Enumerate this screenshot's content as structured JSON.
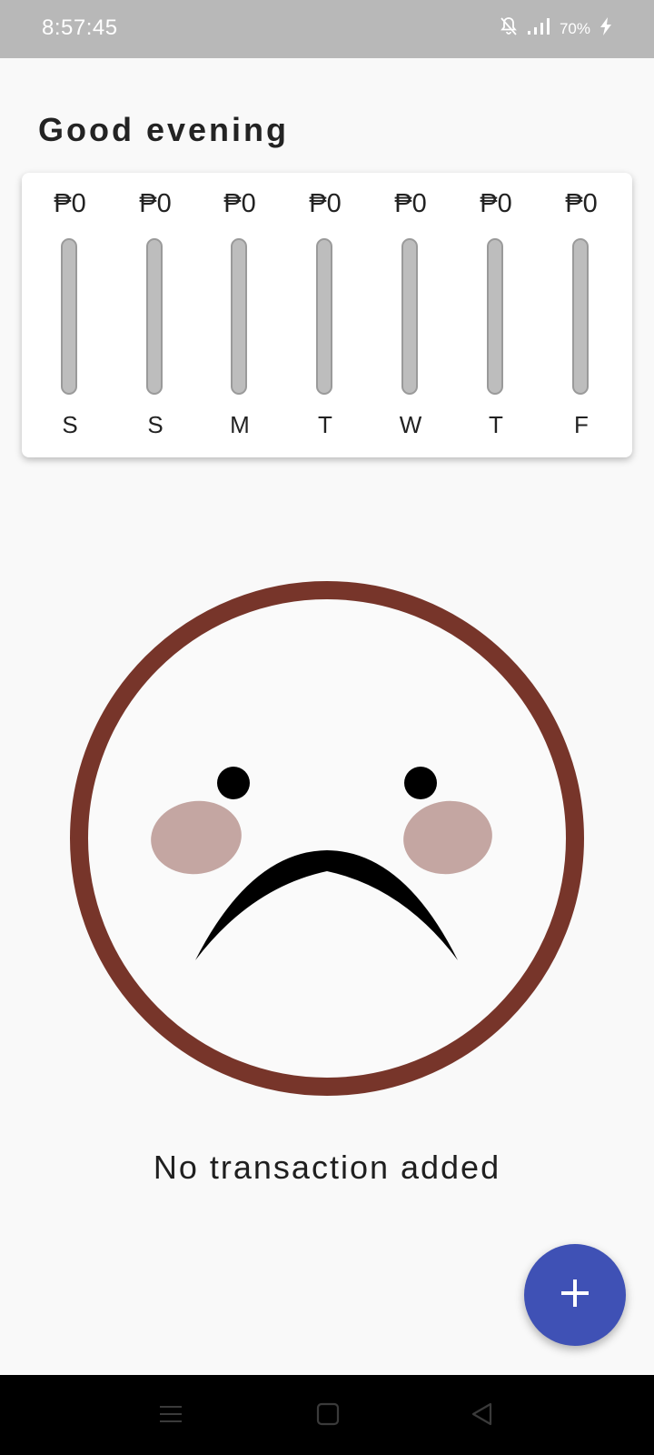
{
  "status_bar": {
    "time": "8:57:45",
    "battery": "70%"
  },
  "greeting": "Good evening",
  "weekly_chart": {
    "days": [
      {
        "label": "S",
        "amount": "₱0"
      },
      {
        "label": "S",
        "amount": "₱0"
      },
      {
        "label": "M",
        "amount": "₱0"
      },
      {
        "label": "T",
        "amount": "₱0"
      },
      {
        "label": "W",
        "amount": "₱0"
      },
      {
        "label": "T",
        "amount": "₱0"
      },
      {
        "label": "F",
        "amount": "₱0"
      }
    ],
    "bar_fill_levels": [
      0,
      0,
      0,
      0,
      0,
      0,
      0
    ]
  },
  "empty_state": {
    "message": "No transaction added",
    "illustration": "sad-face"
  },
  "fab": {
    "icon": "plus-icon",
    "color": "#3f51b5"
  },
  "colors": {
    "accent": "#3f51b5",
    "face_outline": "#77352a",
    "cheek": "#c4a6a2",
    "bar": "#bdbdbd"
  },
  "nav_bar": {
    "icons": [
      "menu-icon",
      "home-icon",
      "back-icon"
    ]
  }
}
